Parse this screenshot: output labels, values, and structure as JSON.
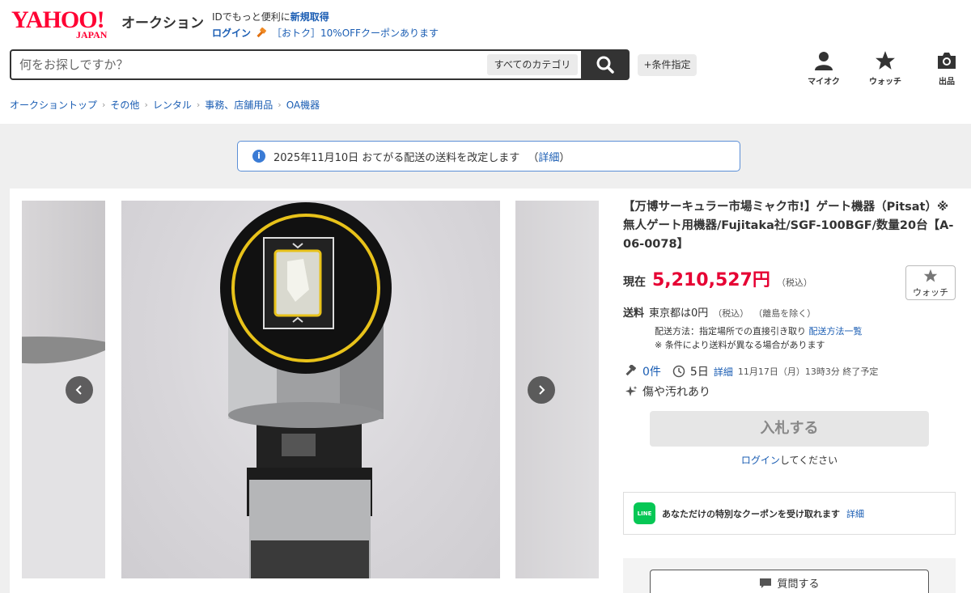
{
  "header": {
    "logo_text": "YAHOO!",
    "logo_sub": "JAPAN",
    "service_name": "オークション",
    "promo_line1_prefix": "IDでもっと便利に",
    "promo_line1_link": "新規取得",
    "login_link": "ログイン",
    "coupon_text": "［おトク］10%OFFクーポンあります"
  },
  "search": {
    "placeholder": "何をお探しですか？",
    "category_button": "すべてのカテゴリ",
    "condition_button": "+条件指定"
  },
  "header_icons": [
    {
      "label": "マイオク",
      "icon": "user-icon"
    },
    {
      "label": "ウォッチ",
      "icon": "star-icon"
    },
    {
      "label": "出品",
      "icon": "camera-icon"
    }
  ],
  "breadcrumb": [
    "オークショントップ",
    "その他",
    "レンタル",
    "事務、店舗用品",
    "OA機器"
  ],
  "notice": {
    "text": "2025年11月10日 おてがる配送の送料を改定します",
    "paren_open": "（",
    "link": "詳細",
    "paren_close": "）"
  },
  "product": {
    "title": "【万博サーキュラー市場ミャク市!】ゲート機器（Pitsat）※無人ゲート用機器/Fujitaka社/SGF-100BGF/数量20台【A-06-0078】",
    "price_label": "現在",
    "price": "5,210,527円",
    "price_tax": "（税込）",
    "watch_label": "ウォッチ",
    "shipping_label": "送料",
    "shipping_value": "東京都は0円",
    "shipping_tax": "（税込）",
    "shipping_note": "（離島を除く）",
    "delivery_method": "配送方法：指定場所での直接引き取り",
    "delivery_link": "配送方法一覧",
    "delivery_note": "※ 条件により送料が異なる場合があります",
    "bids": "0件",
    "time_left": "5日",
    "time_detail_link": "詳細",
    "end_time": "11月17日（月）13時3分 終了予定",
    "condition": "傷や汚れあり",
    "bid_button": "入札する",
    "login_link": "ログイン",
    "login_suffix": "してください",
    "line_coupon_text": "あなただけの特別なクーポンを受け取れます",
    "line_coupon_link": "詳細",
    "line_logo": "LINE",
    "question_button": "質問する"
  },
  "colors": {
    "brand_red": "#ff0033",
    "price_red": "#e60033",
    "link_blue": "#1a5db3",
    "line_green": "#06c755"
  }
}
